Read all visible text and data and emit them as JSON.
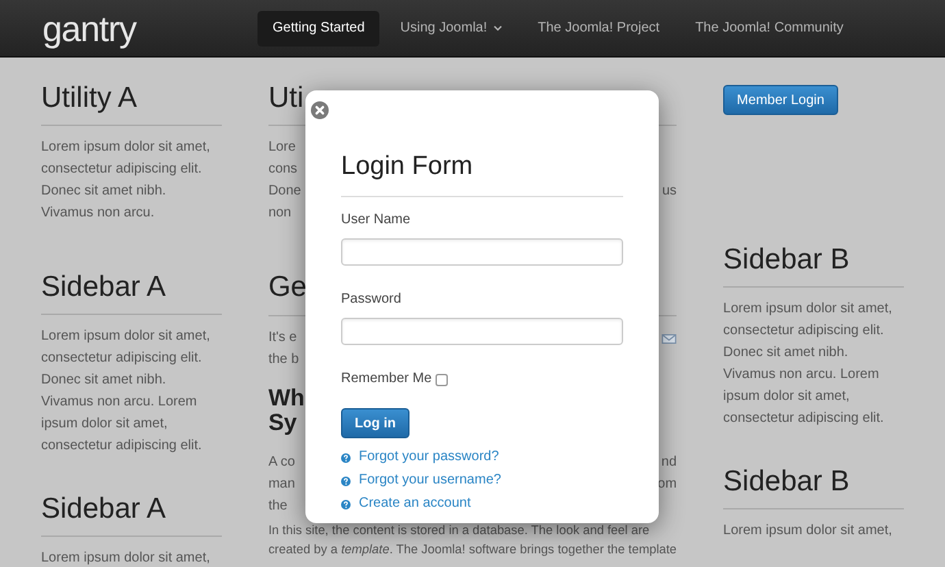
{
  "header": {
    "logo": "gantry",
    "nav": [
      {
        "label": "Getting Started",
        "selected": true,
        "dropdown": false
      },
      {
        "label": "Using Joomla!",
        "selected": false,
        "dropdown": true
      },
      {
        "label": "The Joomla! Project",
        "selected": false,
        "dropdown": false
      },
      {
        "label": "The Joomla! Community",
        "selected": false,
        "dropdown": false
      }
    ]
  },
  "left_column": [
    {
      "title": "Utility A",
      "text": "Lorem ipsum dolor sit amet, consectetur adipiscing elit. Donec sit amet nibh. Vivamus non arcu."
    },
    {
      "title": "Sidebar A",
      "text": "Lorem ipsum dolor sit amet, consectetur adipiscing elit. Donec sit amet nibh. Vivamus non arcu. Lorem ipsum dolor sit amet, consectetur adipiscing elit."
    },
    {
      "title": "Sidebar A",
      "text": "Lorem ipsum dolor sit amet,"
    }
  ],
  "middle_top": {
    "heading": "Uti",
    "rows": [
      {
        "left": "Lore"
      },
      {
        "left": "cons"
      },
      {
        "left": "Done",
        "right": "us"
      },
      {
        "left": "non"
      }
    ]
  },
  "article": {
    "heading": "Ge",
    "intro_rows": [
      {
        "left": "It's e",
        "icons": true
      },
      {
        "left": "the b",
        "icons": false
      }
    ],
    "subheading_rows": [
      "Wh",
      "Sy"
    ],
    "rows": [
      {
        "left": "A co",
        "right": "nd"
      },
      {
        "left": "man",
        "right": "om"
      },
      {
        "left": "the"
      }
    ],
    "lines": [
      "In this site, the content is stored in a database. The look and feel are",
      "created by a *template*. The Joomla! software brings together the template"
    ]
  },
  "right_column": {
    "button": "Member Login",
    "sections": [
      {
        "title": "Sidebar B",
        "text": "Lorem ipsum dolor sit amet, consectetur adipiscing elit. Donec sit amet nibh. Vivamus non arcu. Lorem ipsum dolor sit amet, consectetur adipiscing elit."
      },
      {
        "title": "Sidebar B",
        "text": "Lorem ipsum dolor sit amet,"
      }
    ]
  },
  "modal": {
    "title": "Login Form",
    "fields": [
      {
        "label": "User Name"
      },
      {
        "label": "Password"
      }
    ],
    "remember": {
      "label": "Remember Me",
      "checked": false
    },
    "submit": "Log in",
    "links": [
      "Forgot your password?",
      "Forgot your username?",
      "Create an account"
    ]
  }
}
